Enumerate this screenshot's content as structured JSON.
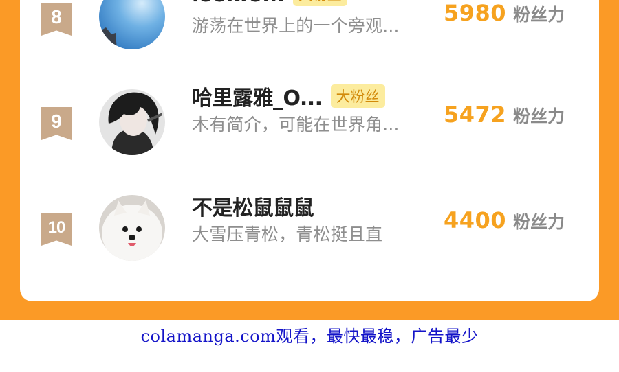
{
  "leaderboard": {
    "rows": [
      {
        "rank": "8",
        "name": "lookfo...",
        "tag": "大粉丝",
        "bio": "游荡在世界上的一个旁观...",
        "score": "5980",
        "score_unit": "粉丝力",
        "avatar_icon": "sky-avatar-icon"
      },
      {
        "rank": "9",
        "name": "哈里露雅_O...",
        "tag": "大粉丝",
        "bio": "木有简介，可能在世界角...",
        "score": "5472",
        "score_unit": "粉丝力",
        "avatar_icon": "dark-hair-boy-avatar-icon"
      },
      {
        "rank": "10",
        "name": "不是松鼠鼠鼠",
        "bio": "大雪压青松，青松挺且直",
        "score": "4400",
        "score_unit": "粉丝力",
        "avatar_icon": "white-dog-avatar-icon"
      }
    ]
  },
  "footer": {
    "watermark": "colamanga.com观看，最快最稳，广告最少"
  },
  "colors": {
    "background": "#fb9a26",
    "score": "#f6a21f",
    "tag_bg": "#fcec9e",
    "tag_text": "#d28a0a",
    "rank_badge": "#c9a98a",
    "watermark": "#1414c8"
  }
}
